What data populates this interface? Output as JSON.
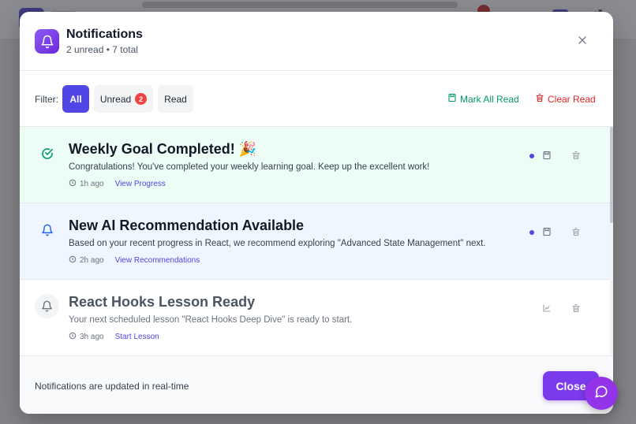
{
  "header": {
    "title": "Notifications",
    "subtitle": "2 unread • 7 total",
    "icon": "bell-icon"
  },
  "filter": {
    "label": "Filter:",
    "all_label": "All",
    "unread_label": "Unread",
    "unread_count": "2",
    "read_label": "Read",
    "selected": "All"
  },
  "actions": {
    "mark_all_read": "Mark All Read",
    "clear_read": "Clear Read"
  },
  "notifications": [
    {
      "title": "Weekly Goal Completed! 🎉",
      "message": "Congratulations! You've completed your weekly learning goal. Keep up the excellent work!",
      "time": "1h ago",
      "link": "View Progress",
      "unread": true,
      "icon": "check-circle-icon"
    },
    {
      "title": "New AI Recommendation Available",
      "message": "Based on your recent progress in React, we recommend exploring \"Advanced State Management\" next.",
      "time": "2h ago",
      "link": "View Recommendations",
      "unread": true,
      "icon": "bell-icon"
    },
    {
      "title": "React Hooks Lesson Ready",
      "message": "Your next scheduled lesson \"React Hooks Deep Dive\" is ready to start.",
      "time": "3h ago",
      "link": "Start Lesson",
      "unread": false,
      "icon": "bell-icon"
    }
  ],
  "footer": {
    "note": "Notifications are updated in real-time",
    "close_label": "Close"
  },
  "colors": {
    "accent": "#4f46e5",
    "brand": "#7c3aed",
    "success": "#059669",
    "danger": "#dc2626",
    "goal_bg": "#ecfdf5",
    "recommend_bg": "#eff6ff"
  }
}
